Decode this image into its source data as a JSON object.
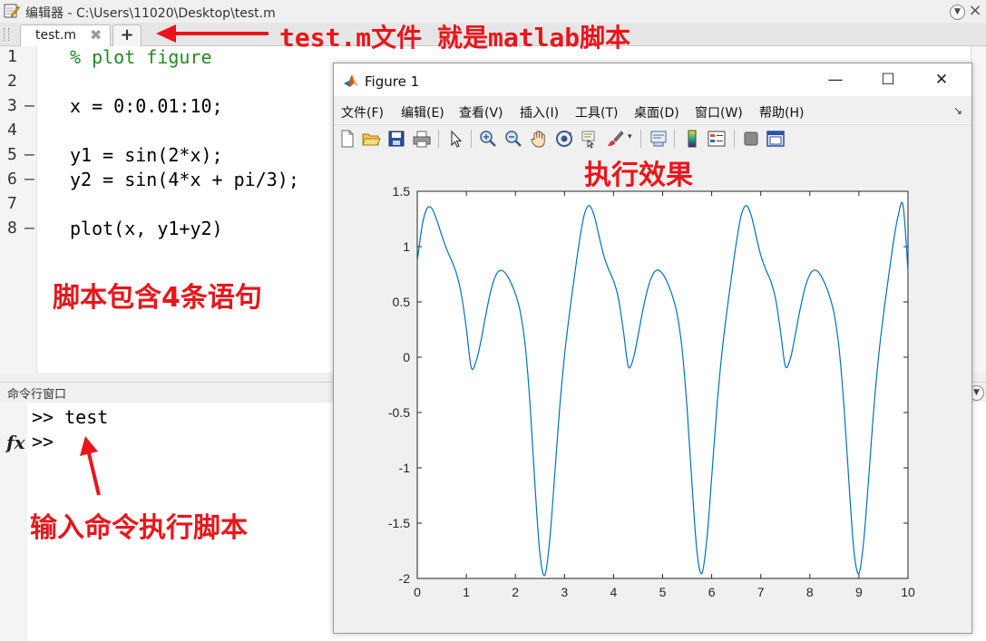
{
  "editor": {
    "title": "编辑器 - C:\\Users\\11020\\Desktop\\test.m",
    "tab_label": "test.m",
    "tab_close": "✖",
    "tab_add": "+",
    "line_numbers": [
      "1",
      "2",
      "3",
      "4",
      "5",
      "6",
      "7",
      "8"
    ],
    "line_dashes": [
      "—",
      "—",
      "—",
      "—",
      "—"
    ],
    "lines": [
      "% plot figure",
      "x = 0:0.01:10;",
      "y1 = sin(2*x);",
      "y2 = sin(4*x + pi/3);",
      "plot(x, y1+y2)"
    ]
  },
  "command_window": {
    "title": "命令行窗口",
    "lines": [
      ">> test",
      ">>"
    ],
    "fx_label": "fx"
  },
  "annotations": {
    "tab_note": "test.m文件 就是matlab脚本",
    "script_note": "脚本包含4条语句",
    "cmd_note": "输入命令执行脚本",
    "effect_note": "执行效果"
  },
  "figure": {
    "title": "Figure 1",
    "menus": [
      "文件(F)",
      "编辑(E)",
      "查看(V)",
      "插入(I)",
      "工具(T)",
      "桌面(D)",
      "窗口(W)",
      "帮助(H)"
    ],
    "toolbar_icons": [
      "new-file-icon",
      "open-folder-icon",
      "save-icon",
      "print-icon",
      "pointer-icon",
      "zoom-in-icon",
      "zoom-out-icon",
      "pan-hand-icon",
      "rotate-3d-icon",
      "data-cursor-icon",
      "brush-icon",
      "link-plot-icon",
      "colorbar-icon",
      "legend-icon",
      "hide-tools-icon",
      "dock-icon"
    ]
  },
  "colors": {
    "line": "#0072BD",
    "annotation": "#E8161B"
  },
  "chart_data": {
    "type": "line",
    "title": "",
    "xlabel": "",
    "ylabel": "",
    "xlim": [
      0,
      10
    ],
    "ylim": [
      -2,
      1.5
    ],
    "xticks": [
      "0",
      "1",
      "2",
      "3",
      "4",
      "5",
      "6",
      "7",
      "8",
      "9",
      "10"
    ],
    "yticks": [
      "-2",
      "-1.5",
      "-1",
      "-0.5",
      "0",
      "0.5",
      "1",
      "1.5"
    ],
    "grid": false,
    "legend": "none",
    "series": [
      {
        "x": [
          0,
          0.1,
          0.2,
          0.3,
          0.4,
          0.5,
          0.6,
          0.7,
          0.8,
          0.9,
          1.0,
          1.1,
          1.2,
          1.3,
          1.4,
          1.5,
          1.6,
          1.7,
          1.8,
          1.9,
          2.0,
          2.1,
          2.2,
          2.3,
          2.4,
          2.5,
          2.6,
          2.7,
          2.8,
          2.9,
          3.0,
          3.1,
          3.2,
          3.3,
          3.4,
          3.5,
          3.6,
          3.7,
          3.8,
          3.9,
          4.0,
          4.1,
          4.2,
          4.3,
          4.4,
          4.5,
          4.6,
          4.7,
          4.8,
          4.9,
          5.0,
          5.1,
          5.2,
          5.3,
          5.4,
          5.5,
          5.6,
          5.7,
          5.8,
          5.9,
          6.0,
          6.1,
          6.2,
          6.3,
          6.4,
          6.5,
          6.6,
          6.7,
          6.8,
          6.9,
          7.0,
          7.1,
          7.2,
          7.3,
          7.4,
          7.5,
          7.6,
          7.7,
          7.8,
          7.9,
          8.0,
          8.1,
          8.2,
          8.3,
          8.4,
          8.5,
          8.6,
          8.7,
          8.8,
          8.9,
          9.0,
          9.1,
          9.2,
          9.3,
          9.4,
          9.5,
          9.6,
          9.7,
          9.8,
          9.9,
          10.0
        ],
        "values": [
          0.866,
          1.19,
          1.346,
          1.343,
          1.237,
          1.1,
          0.976,
          0.873,
          0.756,
          0.565,
          0.263,
          -0.093,
          -0.035,
          0.152,
          0.39,
          0.603,
          0.74,
          0.786,
          0.758,
          0.682,
          0.573,
          0.41,
          0.108,
          -0.436,
          -1.165,
          -1.779,
          -1.972,
          -1.65,
          -1.069,
          -0.469,
          0.011,
          0.39,
          0.721,
          1.036,
          1.282,
          1.371,
          1.289,
          1.103,
          0.92,
          0.793,
          0.692,
          0.531,
          0.241,
          -0.083,
          -0.017,
          0.197,
          0.431,
          0.625,
          0.748,
          0.788,
          0.755,
          0.671,
          0.554,
          0.38,
          0.06,
          -0.474,
          -1.155,
          -1.757,
          -1.955,
          -1.651,
          -1.086,
          -0.484,
          0.003,
          0.383,
          0.714,
          1.03,
          1.28,
          1.371,
          1.29,
          1.105,
          0.921,
          0.794,
          0.693,
          0.532,
          0.243,
          -0.081,
          -0.018,
          0.195,
          0.429,
          0.624,
          0.748,
          0.788,
          0.756,
          0.672,
          0.555,
          0.381,
          0.062,
          -0.472,
          -1.155,
          -1.758,
          -1.955,
          -1.651,
          -1.085,
          -0.484,
          0.004,
          0.384,
          0.714,
          1.031,
          1.28,
          1.371,
          0.78
        ]
      }
    ]
  }
}
